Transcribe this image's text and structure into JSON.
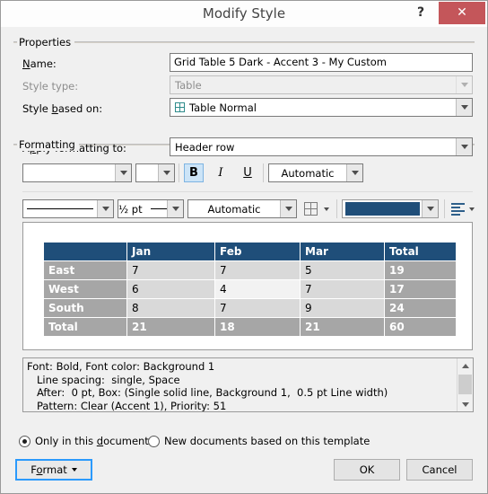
{
  "window": {
    "title": "Modify Style",
    "help_label": "?",
    "close_label": "✕"
  },
  "properties": {
    "group_label": "Properties",
    "name_label": "Name:",
    "name_value": "Grid Table 5 Dark - Accent 3 - My Custom",
    "style_type_label": "Style type:",
    "style_type_value": "Table",
    "style_based_on_label": "Style based on:",
    "style_based_on_value": "Table Normal",
    "style_based_on_icon": "table-grid-icon"
  },
  "formatting": {
    "group_label": "Formatting",
    "apply_to_label": "Apply formatting to:",
    "apply_to_value": "Header row",
    "font_name_value": "",
    "font_size_value": "",
    "bold_label": "B",
    "italic_label": "I",
    "underline_label": "U",
    "font_color_value": "Automatic",
    "border_style_value": "",
    "border_width_value": "½ pt",
    "border_color_value": "Automatic",
    "borders_icon": "borders-grid-icon",
    "fill_color_hex": "#1f4e79",
    "align_icon": "align-left-icon"
  },
  "preview": {
    "table": {
      "columns": [
        "",
        "Jan",
        "Feb",
        "Mar",
        "Total"
      ],
      "rows": [
        {
          "header": "East",
          "cells": [
            "7",
            "7",
            "5",
            "19"
          ]
        },
        {
          "header": "West",
          "cells": [
            "6",
            "4",
            "7",
            "17"
          ]
        },
        {
          "header": "South",
          "cells": [
            "8",
            "7",
            "9",
            "24"
          ]
        },
        {
          "header": "Total",
          "cells": [
            "21",
            "18",
            "21",
            "60"
          ]
        }
      ],
      "header_fill": "#1f4e79",
      "row_header_fill": "#a6a6a6",
      "band_a_fill": "#d9d9d9",
      "band_b_fill": "#f2f2f2"
    }
  },
  "description": {
    "line1": "Font: Bold, Font color: Background 1",
    "line2": "   Line spacing:  single, Space",
    "line3": "   After:  0 pt, Box: (Single solid line, Background 1,  0.5 pt Line width)",
    "line4": "   Pattern: Clear (Accent 1), Priority: 51"
  },
  "scope": {
    "only_document_label": "Only in this document",
    "only_document_selected": true,
    "new_documents_label": "New documents based on this template",
    "new_documents_selected": false
  },
  "actions": {
    "format_label": "Format",
    "ok_label": "OK",
    "cancel_label": "Cancel"
  }
}
